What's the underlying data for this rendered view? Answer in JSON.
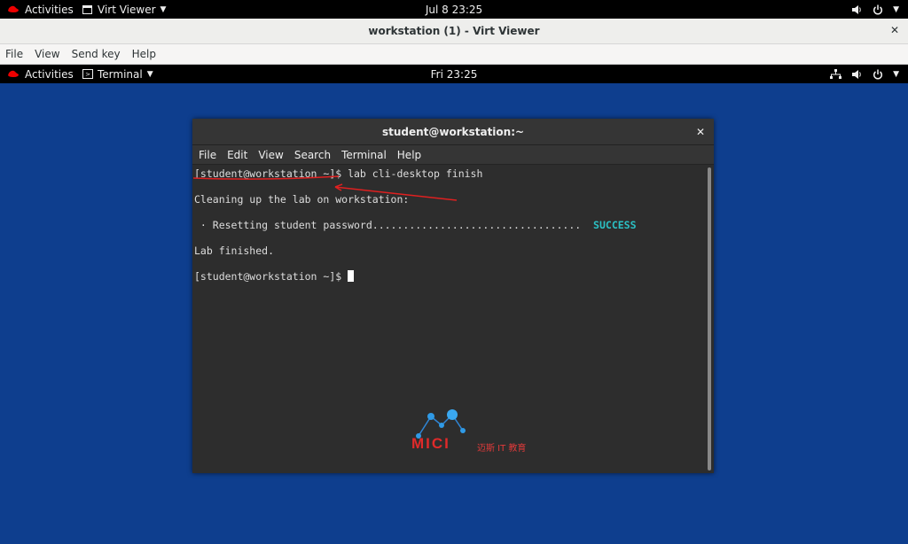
{
  "host_bar": {
    "activities": "Activities",
    "app_menu": "Virt Viewer",
    "clock": "Jul 8  23:25"
  },
  "virt_viewer": {
    "title": "workstation (1) - Virt Viewer",
    "menu": [
      "File",
      "View",
      "Send key",
      "Help"
    ]
  },
  "guest_bar": {
    "activities": "Activities",
    "app_menu": "Terminal",
    "clock": "Fri 23:25"
  },
  "terminal": {
    "title": "student@workstation:~",
    "menu": [
      "File",
      "Edit",
      "View",
      "Search",
      "Terminal",
      "Help"
    ],
    "lines": {
      "cmd": "[student@workstation ~]$ lab cli-desktop finish",
      "cleaning": "Cleaning up the lab on workstation:",
      "reset": " · Resetting student password..................................  ",
      "status": "SUCCESS",
      "finished": "Lab finished.",
      "prompt": "[student@workstation ~]$ "
    }
  },
  "watermark": {
    "brand": "MICI",
    "subtitle": "迈斯 IT 教育"
  },
  "colors": {
    "desktop_bg": "#0e3e8e",
    "success": "#2bc0c4",
    "annotation": "#e02020"
  }
}
